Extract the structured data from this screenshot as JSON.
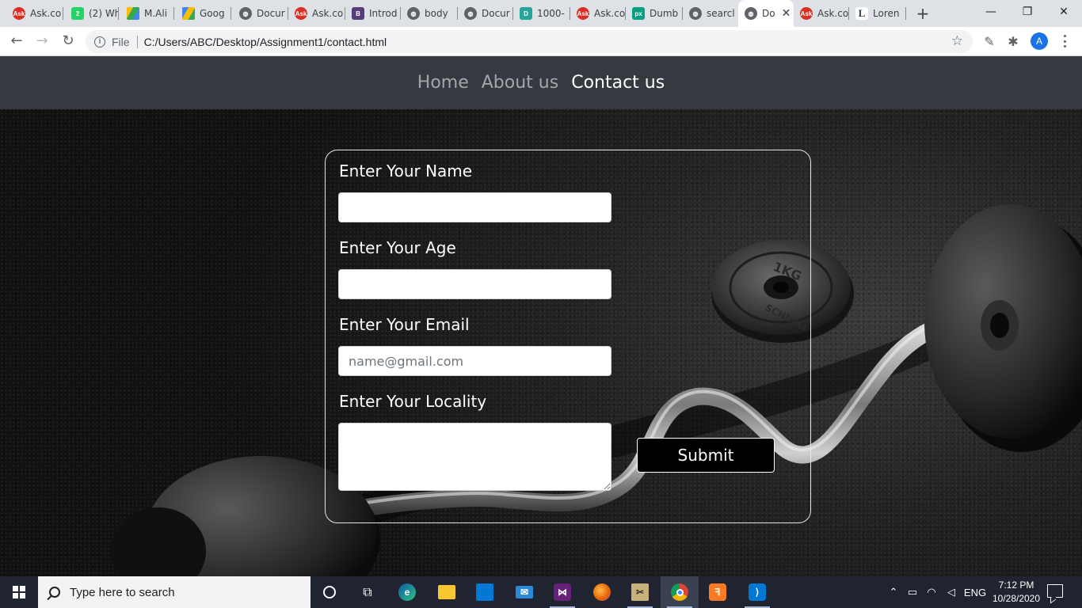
{
  "browser": {
    "tabs": [
      {
        "title": "Ask.co",
        "favicon": "ask-icon",
        "color": "#d93025"
      },
      {
        "title": "(2) Wh",
        "favicon": "whatsapp-icon",
        "color": "#25d366",
        "badge": "2"
      },
      {
        "title": "M.Ali",
        "favicon": "drive-icon",
        "color": "#fbbc04"
      },
      {
        "title": "Goog",
        "favicon": "drive-icon",
        "color": "#34a853"
      },
      {
        "title": "Docur",
        "favicon": "globe-icon",
        "color": "#5f6368"
      },
      {
        "title": "Ask.co",
        "favicon": "ask-icon",
        "color": "#d93025"
      },
      {
        "title": "Introd",
        "favicon": "bootstrap-icon",
        "color": "#563d7c",
        "badge": "B"
      },
      {
        "title": "body",
        "favicon": "globe-icon",
        "color": "#5f6368"
      },
      {
        "title": "Docur",
        "favicon": "globe-icon",
        "color": "#5f6368"
      },
      {
        "title": "1000-",
        "favicon": "d-icon",
        "color": "#26a69a",
        "badge": "D"
      },
      {
        "title": "Ask.co",
        "favicon": "ask-icon",
        "color": "#d93025"
      },
      {
        "title": "Dumb",
        "favicon": "pexels-icon",
        "color": "#05a081",
        "badge": "px"
      },
      {
        "title": "searcl",
        "favicon": "globe-icon",
        "color": "#5f6368"
      },
      {
        "title": "Do",
        "favicon": "globe-icon",
        "color": "#5f6368",
        "active": true
      },
      {
        "title": "Ask.co",
        "favicon": "ask-icon",
        "color": "#d93025"
      },
      {
        "title": "Loren",
        "favicon": "l-icon",
        "color": "#3c4043",
        "badge": "L"
      }
    ],
    "new_tab": "+",
    "controls": {
      "minimize": "—",
      "maximize": "❐",
      "close": "✕"
    },
    "address": {
      "scheme_label": "File",
      "url": "C:/Users/ABC/Desktop/Assignment1/contact.html"
    },
    "profile_initial": "A"
  },
  "site": {
    "nav": [
      {
        "label": "Home",
        "active": false
      },
      {
        "label": "About us",
        "active": false
      },
      {
        "label": "Contact us",
        "active": true
      }
    ],
    "form": {
      "name_label": "Enter Your Name",
      "name_value": "",
      "age_label": "Enter Your Age",
      "age_value": "",
      "email_label": "Enter Your Email",
      "email_placeholder": "name@gmail.com",
      "locality_label": "Enter Your Locality",
      "locality_value": "",
      "submit_label": "Submit"
    }
  },
  "taskbar": {
    "search_placeholder": "Type here to search",
    "apps": [
      "cortana-icon",
      "task-view-icon",
      "edge-icon",
      "file-explorer-icon",
      "store-icon",
      "mail-icon",
      "visual-studio-icon",
      "firefox-icon",
      "tools-icon",
      "chrome-icon",
      "xampp-icon",
      "vscode-icon"
    ],
    "language": "ENG",
    "time": "7:12 PM",
    "date": "10/28/2020"
  },
  "colors": {
    "site_nav_bg": "#343a40",
    "taskbar_bg": "#1f2430",
    "tab_strip_bg": "#dee1e6",
    "profile_blue": "#1a73e8"
  }
}
